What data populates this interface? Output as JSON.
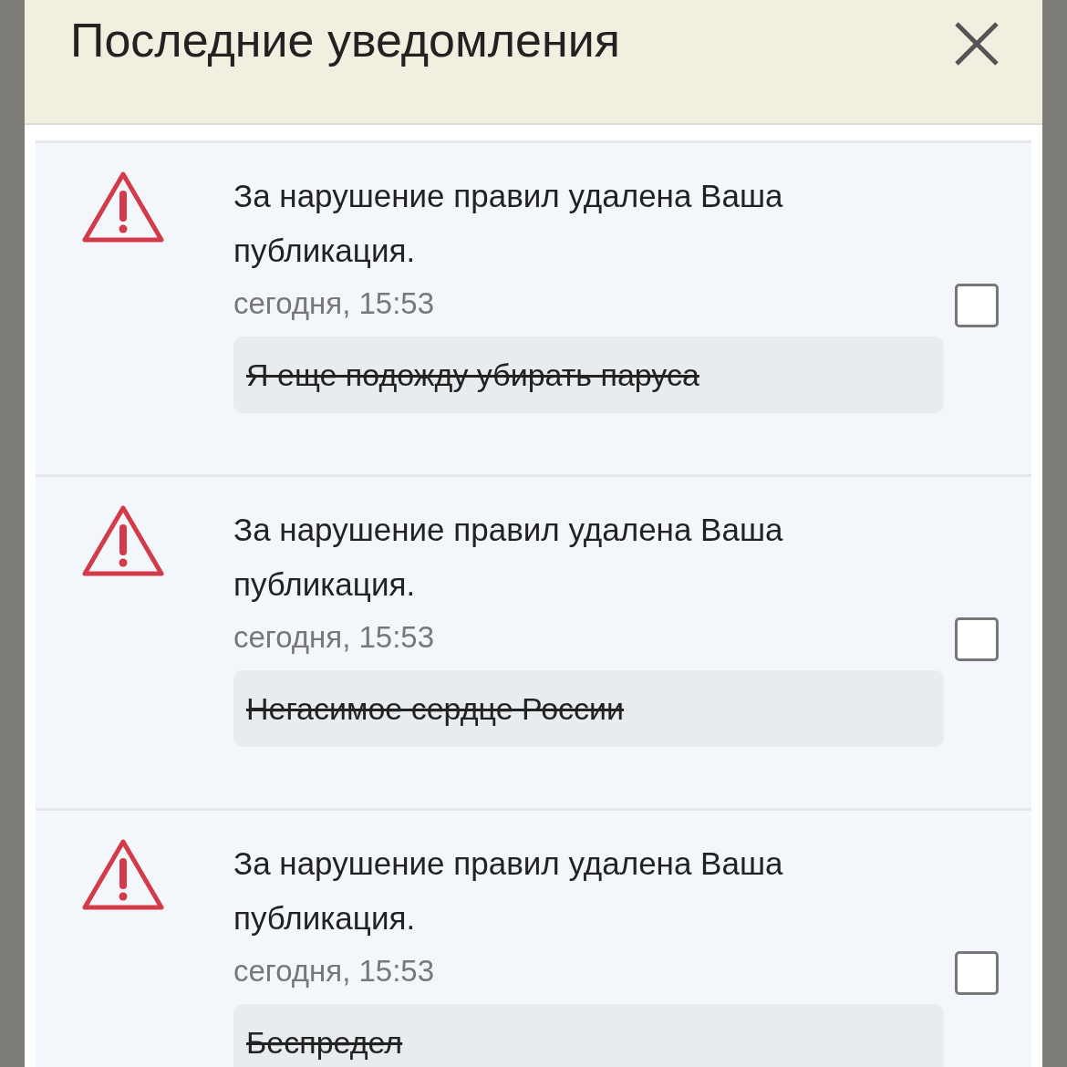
{
  "dialog": {
    "title": "Последние уведомления"
  },
  "notifications": [
    {
      "message": "За нарушение правил удалена Ваша публикация.",
      "time": "сегодня, 15:53",
      "post": "Я еще подожду убирать паруса",
      "checked": false
    },
    {
      "message": "За нарушение правил удалена Ваша публикация.",
      "time": "сегодня, 15:53",
      "post": "Негасимое сердце России",
      "checked": false
    },
    {
      "message": "За нарушение правил удалена Ваша публикация.",
      "time": "сегодня, 15:53",
      "post": "Беспредел",
      "checked": false
    }
  ]
}
